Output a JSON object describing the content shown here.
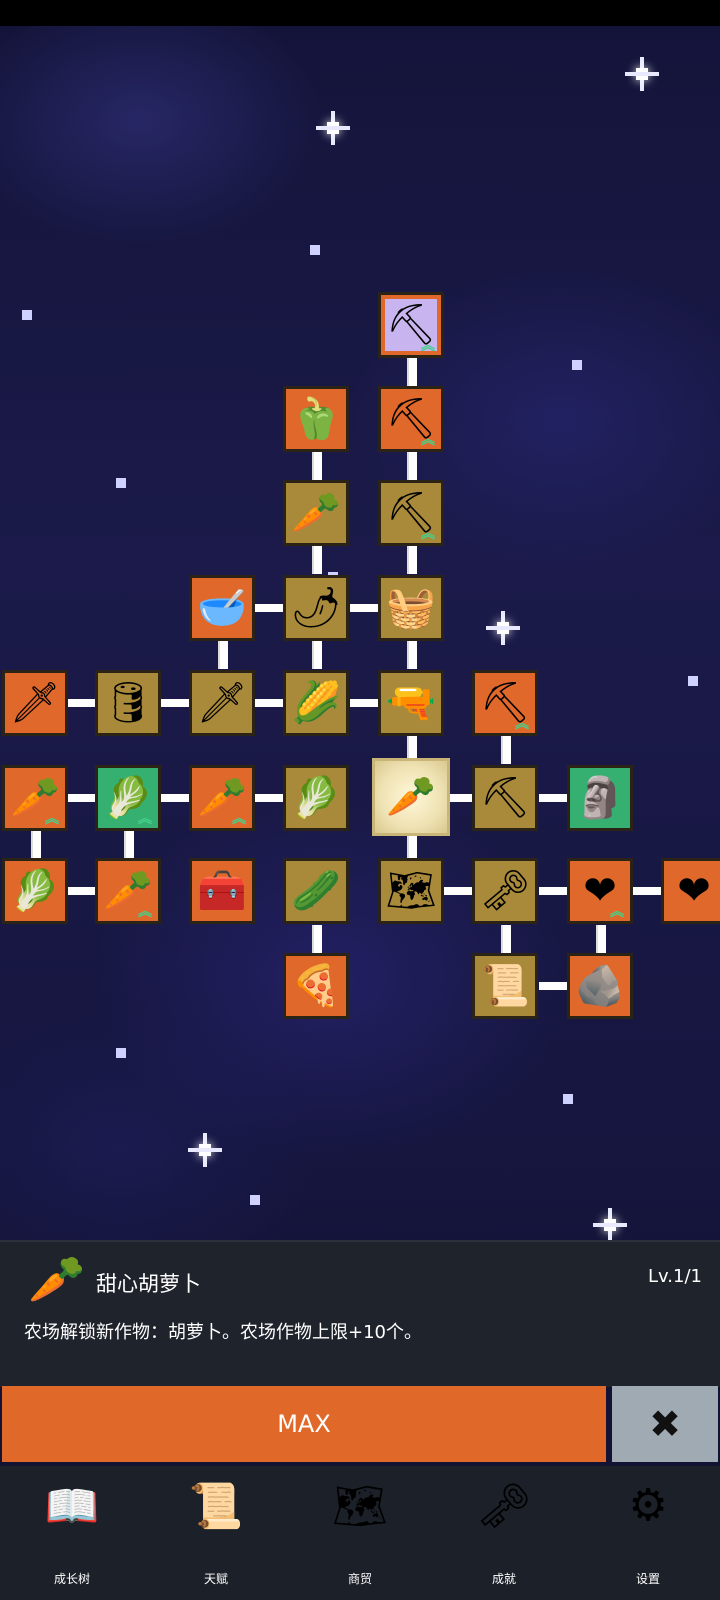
{
  "tree": {
    "nodes": [
      {
        "icon": "shovel-icon",
        "glyph": "⛏",
        "upgrade": true
      },
      {
        "icon": "shovel-icon",
        "glyph": "⛏",
        "upgrade": true
      },
      {
        "icon": "bell-pepper-icon",
        "glyph": "🫑",
        "upgrade": false
      },
      {
        "icon": "radish-icon",
        "glyph": "🥕",
        "upgrade": false
      },
      {
        "icon": "shovel-icon",
        "glyph": "⛏",
        "upgrade": true
      },
      {
        "icon": "bowl-icon",
        "glyph": "🥣",
        "upgrade": false
      },
      {
        "icon": "chili-icon",
        "glyph": "🌶",
        "upgrade": false
      },
      {
        "icon": "basket-icon",
        "glyph": "🧺",
        "upgrade": false
      },
      {
        "icon": "sword-icon",
        "glyph": "🗡",
        "upgrade": false
      },
      {
        "icon": "barrel-icon",
        "glyph": "🛢",
        "upgrade": false
      },
      {
        "icon": "sword-icon",
        "glyph": "🗡",
        "upgrade": false
      },
      {
        "icon": "corn-icon",
        "glyph": "🌽",
        "upgrade": false
      },
      {
        "icon": "rifle-icon",
        "glyph": "🔫",
        "upgrade": false
      },
      {
        "icon": "pickaxe-icon",
        "glyph": "⛏",
        "upgrade": true
      },
      {
        "icon": "carrot-icon",
        "glyph": "🥕",
        "upgrade": true
      },
      {
        "icon": "cabbage-icon",
        "glyph": "🥬",
        "upgrade": true
      },
      {
        "icon": "carrot-icon",
        "glyph": "🥕",
        "upgrade": true
      },
      {
        "icon": "cabbage-icon",
        "glyph": "🥬",
        "upgrade": false
      },
      {
        "icon": "carrot-icon",
        "glyph": "🥕",
        "upgrade": false
      },
      {
        "icon": "pickaxe-icon",
        "glyph": "⛏",
        "upgrade": false
      },
      {
        "icon": "statue-icon",
        "glyph": "🗿",
        "upgrade": false
      },
      {
        "icon": "cabbage-icon",
        "glyph": "🥬",
        "upgrade": false
      },
      {
        "icon": "carrot-icon",
        "glyph": "🥕",
        "upgrade": true
      },
      {
        "icon": "treasure-chest-icon",
        "glyph": "🧰",
        "upgrade": false
      },
      {
        "icon": "leek-icon",
        "glyph": "🥒",
        "upgrade": false
      },
      {
        "icon": "map-icon",
        "glyph": "🗺",
        "upgrade": false
      },
      {
        "icon": "key-icon",
        "glyph": "🗝",
        "upgrade": false
      },
      {
        "icon": "heart-icon",
        "glyph": "❤",
        "upgrade": true
      },
      {
        "icon": "heart-icon",
        "glyph": "❤",
        "upgrade": false
      },
      {
        "icon": "pizza-icon",
        "glyph": "🍕",
        "upgrade": false
      },
      {
        "icon": "scroll-icon",
        "glyph": "📜",
        "upgrade": false
      },
      {
        "icon": "stone-icon",
        "glyph": "🪨",
        "upgrade": false
      }
    ]
  },
  "panel": {
    "icon": "carrot-icon",
    "glyph": "🥕",
    "title": "甜心胡萝卜",
    "level": "Lv.1/1",
    "description": "农场解锁新作物：胡萝卜。农场作物上限+10个。"
  },
  "buttons": {
    "max_label": "MAX",
    "close_glyph": "✖"
  },
  "nav": [
    {
      "label": "成长树",
      "icon": "book-icon",
      "glyph": "📖"
    },
    {
      "label": "天赋",
      "icon": "scroll-icon",
      "glyph": "📜"
    },
    {
      "label": "商贸",
      "icon": "map-icon",
      "glyph": "🗺"
    },
    {
      "label": "成就",
      "icon": "key-icon",
      "glyph": "🗝"
    },
    {
      "label": "设置",
      "icon": "gear-icon",
      "glyph": "⚙"
    }
  ]
}
